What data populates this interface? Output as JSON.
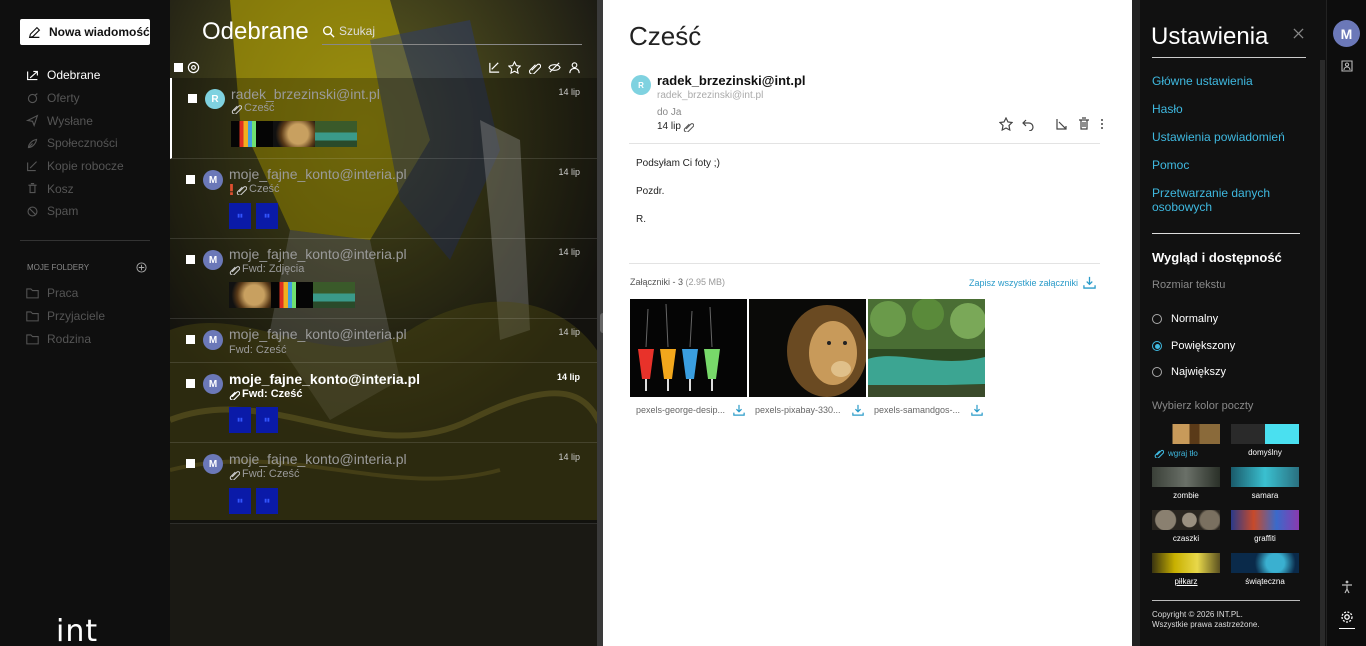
{
  "sidebar": {
    "compose_label": "Nowa wiadomość",
    "nav": [
      {
        "label": "Odebrane",
        "icon": "inbox-icon",
        "active": true
      },
      {
        "label": "Oferty",
        "icon": "offers-icon"
      },
      {
        "label": "Wysłane",
        "icon": "sent-icon"
      },
      {
        "label": "Społeczności",
        "icon": "community-icon"
      },
      {
        "label": "Kopie robocze",
        "icon": "drafts-icon"
      },
      {
        "label": "Kosz",
        "icon": "trash-icon"
      },
      {
        "label": "Spam",
        "icon": "spam-icon"
      }
    ],
    "folders_header": "MOJE FOLDERY",
    "folders": [
      "Praca",
      "Przyjaciele",
      "Rodzina"
    ],
    "logo": "int"
  },
  "list": {
    "title": "Odebrane",
    "search_label": "Szukaj",
    "messages": [
      {
        "from": "radek_brzezinski@int.pl",
        "subject": "Cześć",
        "date": "14 lip",
        "avatar": "R",
        "unread": false
      },
      {
        "from": "moje_fajne_konto@interia.pl",
        "subject": "Cześć",
        "date": "14 lip",
        "avatar": "M",
        "unread": false
      },
      {
        "from": "moje_fajne_konto@interia.pl",
        "subject": "Fwd: Zdjęcia",
        "date": "14 lip",
        "avatar": "M",
        "unread": false
      },
      {
        "from": "moje_fajne_konto@interia.pl",
        "subject": "Fwd: Cześć",
        "date": "14 lip",
        "avatar": "M",
        "unread": false
      },
      {
        "from": "moje_fajne_konto@interia.pl",
        "subject": "Fwd: Cześć",
        "date": "14 lip",
        "avatar": "M",
        "unread": true
      },
      {
        "from": "moje_fajne_konto@interia.pl",
        "subject": "Fwd: Cześć",
        "date": "14 lip",
        "avatar": "M",
        "unread": false
      }
    ]
  },
  "reader": {
    "title": "Cześć",
    "avatar": "R",
    "from_name": "radek_brzezinski@int.pl",
    "from_email": "radek_brzezinski@int.pl",
    "to": "do Ja",
    "date": "14 lip",
    "body": [
      "Podsyłam Ci foty ;)",
      "Pozdr.",
      "R."
    ],
    "attachments_label": "Załączniki - 3",
    "attachments_size": "(2.95 MB)",
    "save_all": "Zapisz wszystkie załączniki",
    "attachments": [
      {
        "name": "pexels-george-desip..."
      },
      {
        "name": "pexels-pixabay-330..."
      },
      {
        "name": "pexels-samandgos-..."
      }
    ]
  },
  "settings": {
    "title": "Ustawienia",
    "links": [
      "Główne ustawienia",
      "Hasło",
      "Ustawienia powiadomień",
      "Pomoc",
      "Przetwarzanie danych osobowych"
    ],
    "appearance_title": "Wygląd i dostępność",
    "text_size_label": "Rozmiar tekstu",
    "text_sizes": [
      "Normalny",
      "Powiększony",
      "Największy"
    ],
    "text_size_selected": "Powiększony",
    "theme_label": "Wybierz kolor poczty",
    "upload_label": "wgraj tło",
    "themes": [
      "domyślny",
      "zombie",
      "samara",
      "czaszki",
      "graffiti",
      "piłkarz",
      "świąteczna"
    ],
    "theme_selected": "piłkarz",
    "copyright_1": "Copyright © 2026 INT.PL.",
    "copyright_2": "Wszystkie prawa zastrzeżone."
  },
  "rail": {
    "avatar": "M"
  },
  "colors": {
    "accent": "#3fb9e0",
    "avatar_m": "#6b78b8",
    "avatar_r": "#7fd2e0"
  }
}
